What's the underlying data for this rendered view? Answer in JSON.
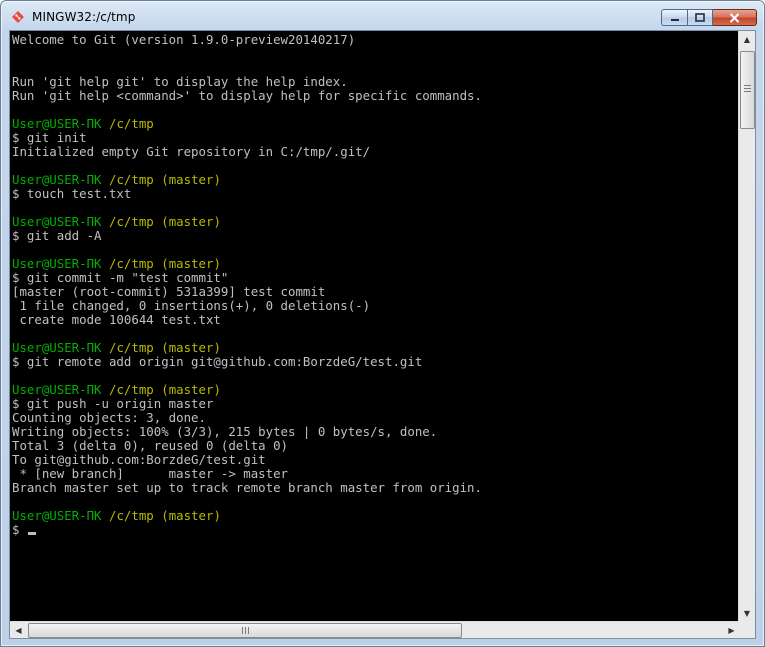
{
  "window": {
    "title": "MINGW32:/c/tmp",
    "icon": "git-diamond-icon",
    "accent_color": "#e74c3c"
  },
  "colors": {
    "background": "#000000",
    "text": "#c0c0c0",
    "prompt_user": "#00b000",
    "prompt_path": "#b9b900"
  },
  "terminal": {
    "lines": [
      {
        "type": "output",
        "text": "Welcome to Git (version 1.9.0-preview20140217)"
      },
      {
        "type": "blank",
        "text": ""
      },
      {
        "type": "blank",
        "text": ""
      },
      {
        "type": "output",
        "text": "Run 'git help git' to display the help index."
      },
      {
        "type": "output",
        "text": "Run 'git help <command>' to display help for specific commands."
      },
      {
        "type": "blank",
        "text": ""
      },
      {
        "type": "prompt",
        "user": "User@USER-ПК",
        "path": "/c/tmp",
        "branch": ""
      },
      {
        "type": "command",
        "text": "$ git init"
      },
      {
        "type": "output",
        "text": "Initialized empty Git repository in C:/tmp/.git/"
      },
      {
        "type": "blank",
        "text": ""
      },
      {
        "type": "prompt",
        "user": "User@USER-ПК",
        "path": "/c/tmp",
        "branch": "(master)"
      },
      {
        "type": "command",
        "text": "$ touch test.txt"
      },
      {
        "type": "blank",
        "text": ""
      },
      {
        "type": "prompt",
        "user": "User@USER-ПК",
        "path": "/c/tmp",
        "branch": "(master)"
      },
      {
        "type": "command",
        "text": "$ git add -A"
      },
      {
        "type": "blank",
        "text": ""
      },
      {
        "type": "prompt",
        "user": "User@USER-ПК",
        "path": "/c/tmp",
        "branch": "(master)"
      },
      {
        "type": "command",
        "text": "$ git commit -m \"test commit\""
      },
      {
        "type": "output",
        "text": "[master (root-commit) 531a399] test commit"
      },
      {
        "type": "output",
        "text": " 1 file changed, 0 insertions(+), 0 deletions(-)"
      },
      {
        "type": "output",
        "text": " create mode 100644 test.txt"
      },
      {
        "type": "blank",
        "text": ""
      },
      {
        "type": "prompt",
        "user": "User@USER-ПК",
        "path": "/c/tmp",
        "branch": "(master)"
      },
      {
        "type": "command",
        "text": "$ git remote add origin git@github.com:BorzdeG/test.git"
      },
      {
        "type": "blank",
        "text": ""
      },
      {
        "type": "prompt",
        "user": "User@USER-ПК",
        "path": "/c/tmp",
        "branch": "(master)"
      },
      {
        "type": "command",
        "text": "$ git push -u origin master"
      },
      {
        "type": "output",
        "text": "Counting objects: 3, done."
      },
      {
        "type": "output",
        "text": "Writing objects: 100% (3/3), 215 bytes | 0 bytes/s, done."
      },
      {
        "type": "output",
        "text": "Total 3 (delta 0), reused 0 (delta 0)"
      },
      {
        "type": "output",
        "text": "To git@github.com:BorzdeG/test.git"
      },
      {
        "type": "output",
        "text": " * [new branch]      master -> master"
      },
      {
        "type": "output",
        "text": "Branch master set up to track remote branch master from origin."
      },
      {
        "type": "blank",
        "text": ""
      },
      {
        "type": "prompt",
        "user": "User@USER-ПК",
        "path": "/c/tmp",
        "branch": "(master)"
      },
      {
        "type": "input",
        "text": "$ "
      }
    ]
  },
  "scrollbars": {
    "vertical": {
      "up": "scroll-up-arrow-icon",
      "down": "scroll-down-arrow-icon"
    },
    "horizontal": {
      "left": "scroll-left-arrow-icon",
      "right": "scroll-right-arrow-icon"
    }
  }
}
